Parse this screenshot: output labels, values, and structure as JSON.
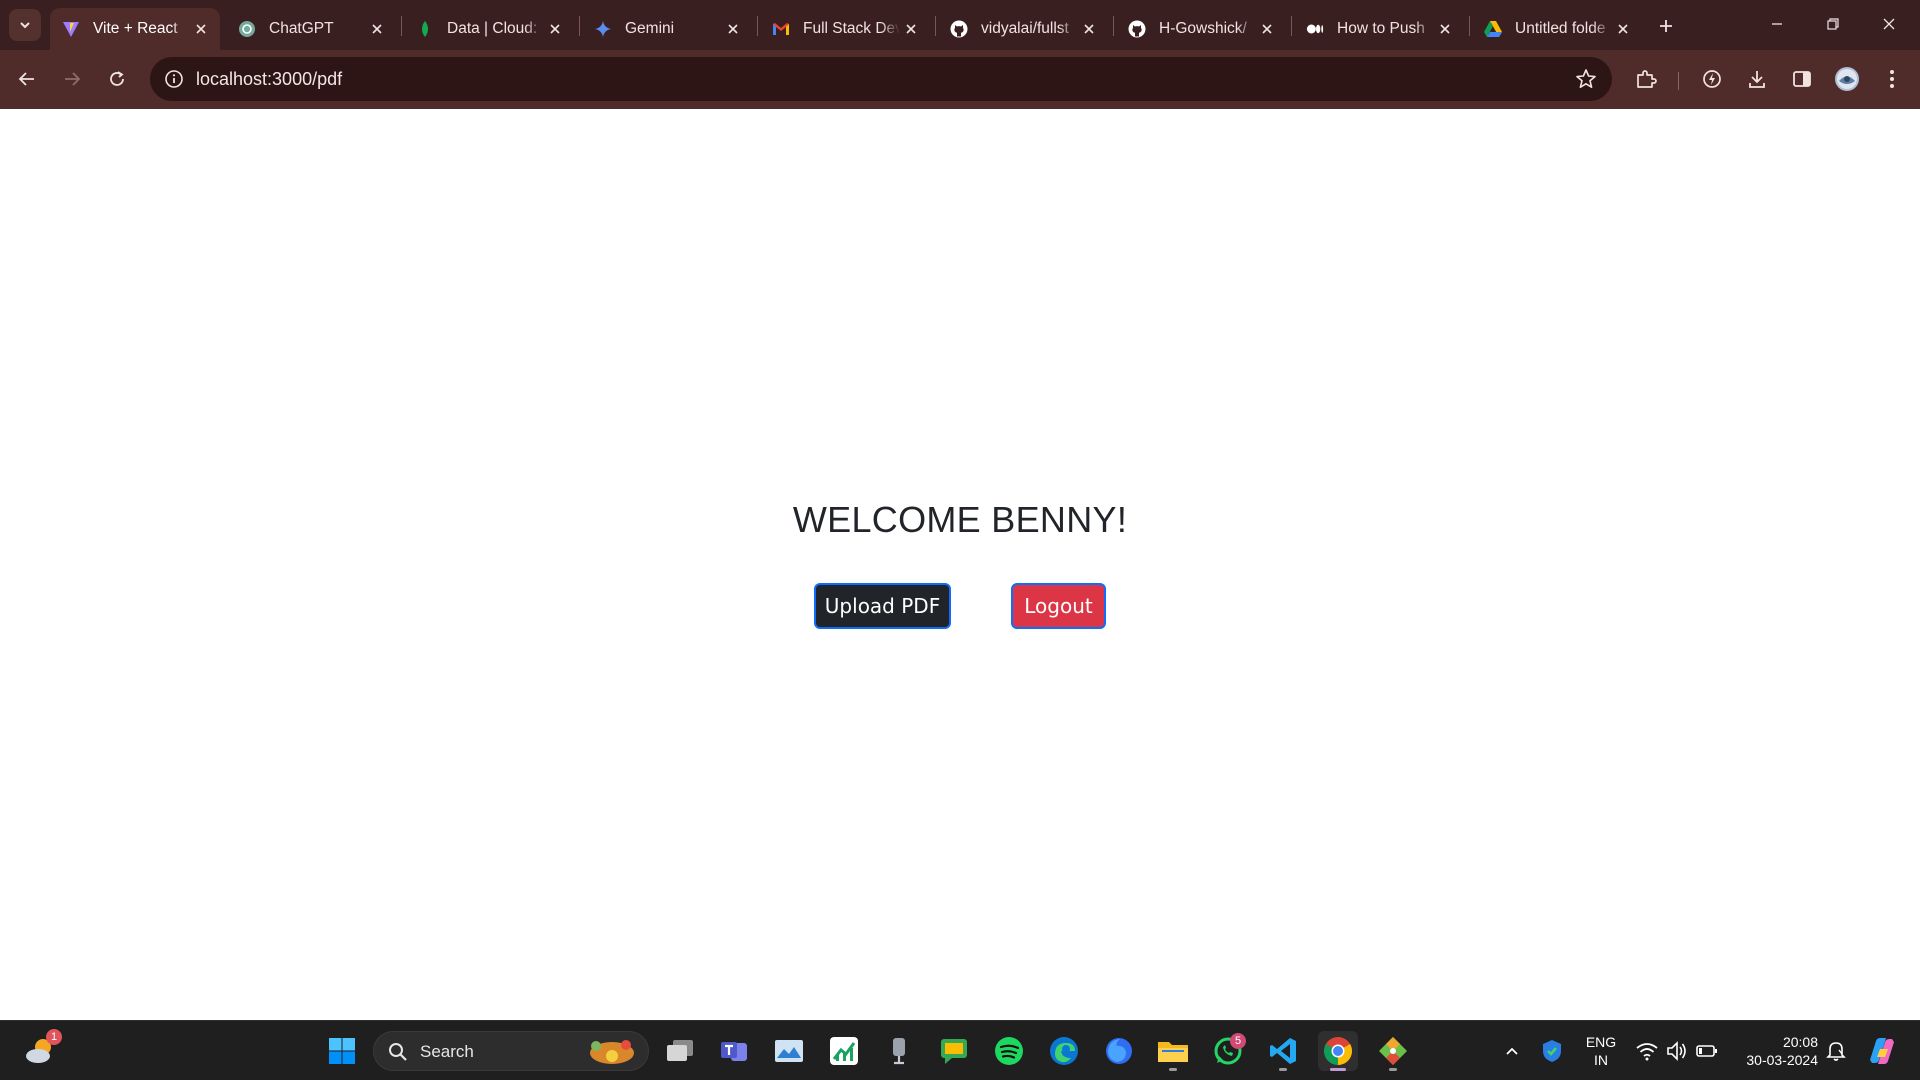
{
  "browser": {
    "tabs": [
      {
        "title": "Vite + React",
        "icon": "vite-icon",
        "active": true
      },
      {
        "title": "ChatGPT",
        "icon": "chatgpt-icon"
      },
      {
        "title": "Data | Cloud:",
        "icon": "mongodb-icon"
      },
      {
        "title": "Gemini",
        "icon": "gemini-icon"
      },
      {
        "title": "Full Stack Dev",
        "icon": "gmail-icon"
      },
      {
        "title": "vidyalai/fullst",
        "icon": "github-icon"
      },
      {
        "title": "H-Gowshick/",
        "icon": "github-icon"
      },
      {
        "title": "How to Push",
        "icon": "medium-icon"
      },
      {
        "title": "Untitled folde",
        "icon": "google-drive-icon"
      }
    ],
    "address_bar": {
      "url": "localhost:3000/pdf"
    }
  },
  "page": {
    "welcome_heading": "WELCOME BENNY!",
    "upload_button_label": "Upload PDF",
    "logout_button_label": "Logout"
  },
  "taskbar": {
    "search_label": "Search",
    "weather_badge": "1",
    "whatsapp_badge": "5",
    "language_line1": "ENG",
    "language_line2": "IN",
    "time": "20:08",
    "date": "30-03-2024"
  },
  "colors": {
    "tab_strip": "#3a1f20",
    "toolbar": "#4f2b2a",
    "upload_button": "#212529",
    "logout_button": "#dc3545",
    "button_border": "#0d6efd",
    "taskbar": "#1f1f1f"
  }
}
